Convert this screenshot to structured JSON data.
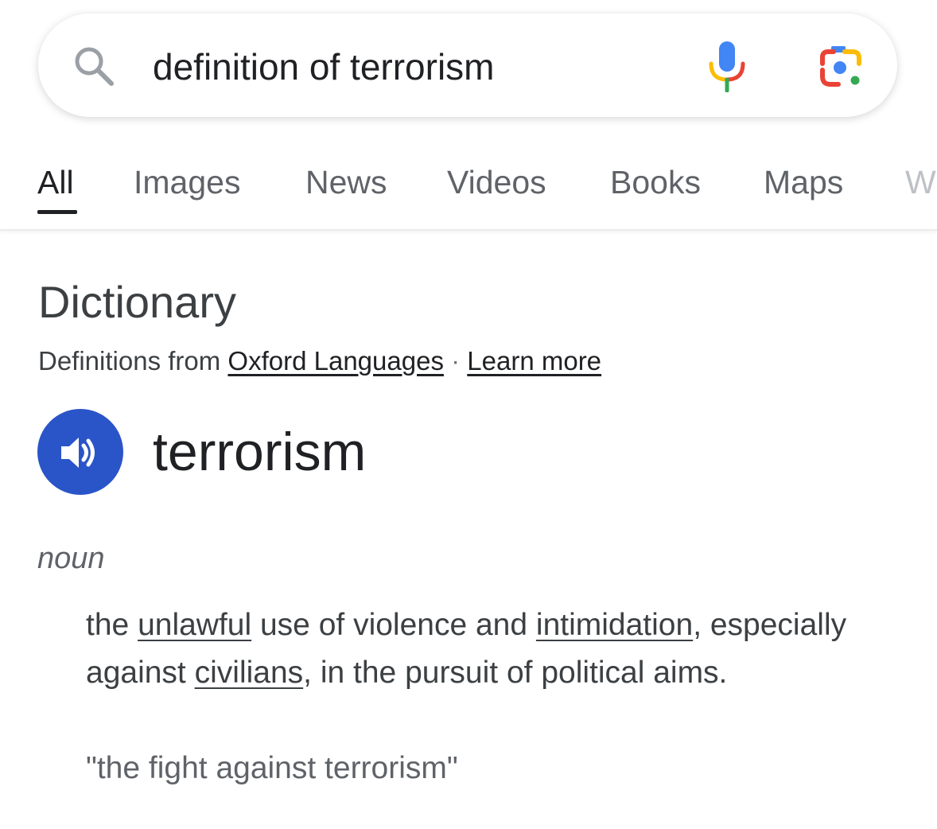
{
  "search": {
    "query": "definition of terrorism",
    "icons": {
      "search": "search-icon",
      "voice": "microphone-icon",
      "lens": "google-lens-icon"
    }
  },
  "tabs": [
    {
      "label": "All",
      "active": true
    },
    {
      "label": "Images",
      "active": false
    },
    {
      "label": "News",
      "active": false
    },
    {
      "label": "Videos",
      "active": false
    },
    {
      "label": "Books",
      "active": false
    },
    {
      "label": "Maps",
      "active": false
    },
    {
      "label": "W",
      "active": false
    }
  ],
  "dictionary": {
    "heading": "Dictionary",
    "source_prefix": "Definitions from ",
    "source_link": "Oxford Languages",
    "separator": " · ",
    "learn_more": "Learn more",
    "pronounce_icon": "speaker-icon",
    "word": "terrorism",
    "part_of_speech": "noun",
    "definition_parts": {
      "p1": "the ",
      "link1": "unlawful",
      "p2": " use of violence and ",
      "link2": "intimidation",
      "p3": ", especially against ",
      "link3": "civilians",
      "p4": ", in the pursuit of political aims."
    },
    "example": "\"the fight against terrorism\""
  },
  "colors": {
    "accent_blue": "#2a55c8",
    "text_primary": "#202124",
    "text_secondary": "#5f6368"
  }
}
